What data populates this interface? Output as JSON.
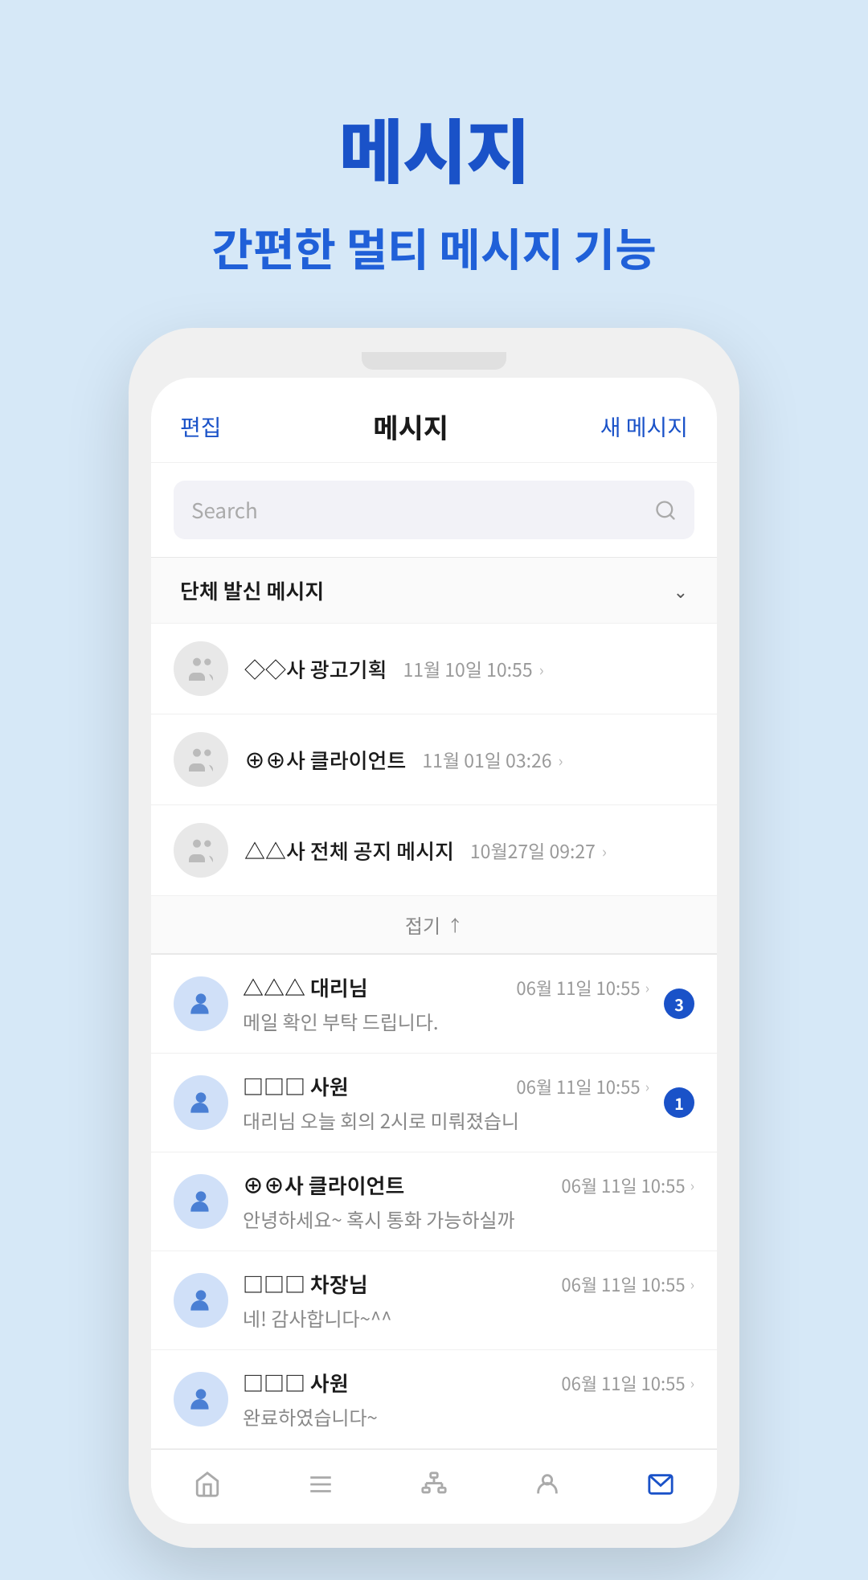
{
  "header": {
    "main_title": "메시지",
    "sub_title": "간편한 멀티 메시지 기능"
  },
  "app": {
    "edit_label": "편집",
    "title_label": "메시지",
    "new_message_label": "새 메시지",
    "search_placeholder": "Search",
    "group_section_label": "단체 발신 메시지",
    "collapse_label": "접기",
    "group_items": [
      {
        "name": "◇◇사 광고기획",
        "time": "11월 10일 10:55"
      },
      {
        "name": "⊕⊕사 클라이언트",
        "time": "11월 01일 03:26"
      },
      {
        "name": "△△사 전체 공지 메시지",
        "time": "10월27일 09:27"
      }
    ],
    "messages": [
      {
        "name": "△△△ 대리님",
        "preview": "메일 확인 부탁 드립니다.",
        "time": "06월 11일 10:55",
        "badge": 3
      },
      {
        "name": "□□□ 사원",
        "preview": "대리님 오늘 회의 2시로 미뤄졌습니",
        "time": "06월 11일 10:55",
        "badge": 1
      },
      {
        "name": "⊕⊕사 클라이언트",
        "preview": "안녕하세요~ 혹시 통화 가능하실까",
        "time": "06월 11일 10:55",
        "badge": 0
      },
      {
        "name": "□□□ 차장님",
        "preview": "네! 감사합니다~^^",
        "time": "06월 11일 10:55",
        "badge": 0
      },
      {
        "name": "□□□ 사원",
        "preview": "완료하였습니다~",
        "time": "06월 11일 10:55",
        "badge": 0
      }
    ]
  },
  "nav": {
    "home": "🏠",
    "menu": "≡",
    "org": "⊞",
    "profile": "👤",
    "mail": "✉"
  }
}
